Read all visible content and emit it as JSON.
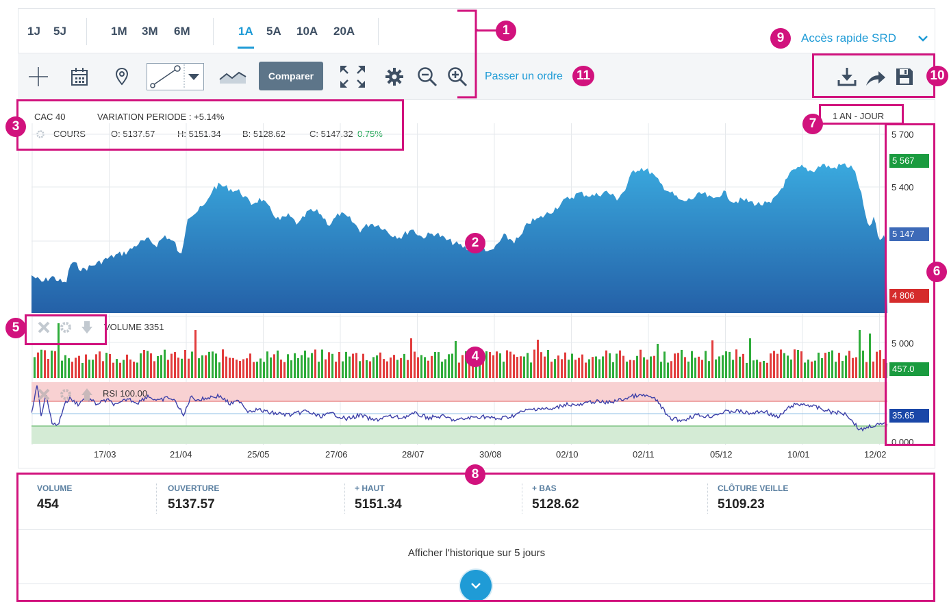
{
  "periods": [
    "1J",
    "5J",
    "1M",
    "3M",
    "6M",
    "1A",
    "5A",
    "10A",
    "20A"
  ],
  "active_period": "1A",
  "quick_access": "Accès rapide SRD",
  "toolbar": {
    "compare_label": "Comparer",
    "order_link": "Passer un ordre"
  },
  "instrument": {
    "name": "CAC 40",
    "variation": "VARIATION PERIODE : +5.14%",
    "series_label": "COURS",
    "open": "O: 5137.57",
    "high": "H: 5151.34",
    "low": "B: 5128.62",
    "close": "C: 5147.32",
    "change": "0.75%",
    "period_badge": "1 AN - JOUR"
  },
  "axis": {
    "price_labels": [
      "5 700",
      "5 400",
      "5 000",
      "0.000"
    ],
    "tags": {
      "high": "5 567",
      "current": "5 147",
      "low": "4 806",
      "volume": "457.0",
      "rsi": "35.65"
    },
    "dates": [
      "17/03",
      "21/04",
      "25/05",
      "27/06",
      "28/07",
      "30/08",
      "02/10",
      "02/11",
      "05/12",
      "10/01",
      "12/02"
    ]
  },
  "indicators": {
    "volume_label": "VOLUME 3351",
    "rsi_label": "RSI 100.00"
  },
  "stats": [
    {
      "title": "VOLUME",
      "value": "454"
    },
    {
      "title": "OUVERTURE",
      "value": "5137.57"
    },
    {
      "title": "+ HAUT",
      "value": "5151.34"
    },
    {
      "title": "+ BAS",
      "value": "5128.62"
    },
    {
      "title": "CLÔTURE VEILLE",
      "value": "5109.23"
    }
  ],
  "history_label": "Afficher l'historique sur 5 jours",
  "annotations": [
    "1",
    "2",
    "3",
    "4",
    "5",
    "6",
    "7",
    "8",
    "9",
    "10",
    "11"
  ],
  "colors": {
    "accent": "#1f9bd6",
    "area_top": "#3aa9de",
    "area_bottom": "#2460a7",
    "up": "#2eac3a",
    "down": "#e23d3d",
    "rsi_line": "#3d40a8",
    "annotation": "#d1127d",
    "tag_high": "#1a9b3f",
    "tag_current": "#3d6ab8",
    "tag_low": "#d52b2b",
    "tag_rsi": "#1a47a8"
  }
}
